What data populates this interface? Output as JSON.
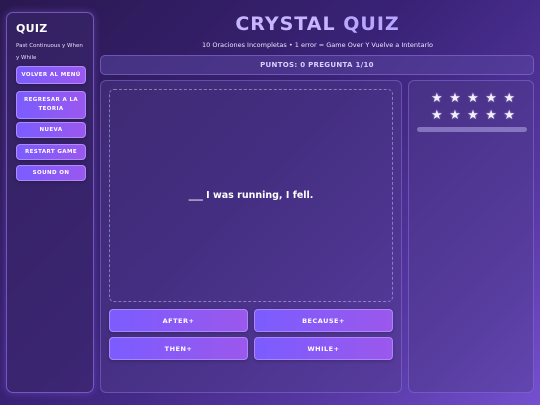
{
  "sidebar": {
    "title": "QUIZ",
    "subtitle": "Past Continuous y When y While",
    "buttons": [
      "VOLVER AL MENÚ",
      "REGRESAR A LA TEORIA",
      "NUEVA",
      "RESTART GAME",
      "SOUND ON"
    ]
  },
  "header": {
    "title_part1": "CRYSTAL",
    "title_part2": "QUIZ",
    "subtitle": "10 Oraciones Incompletas • 1 error = Game Over Y Vuelve a Intentarlo"
  },
  "score": {
    "text": "PUNTOS: 0 PREGUNTA 1/10"
  },
  "question": {
    "text": "___ I was running, I fell."
  },
  "options": [
    "AFTER+",
    "BECAUSE+",
    "THEN+",
    "WHILE+"
  ],
  "stars": {
    "total": 10,
    "icon": "star-icon"
  },
  "progress": {
    "fraction": 0.0
  },
  "colors": {
    "accent": "#7b5cff",
    "accent2": "#9a58ee",
    "title": "#c7b6ff"
  }
}
